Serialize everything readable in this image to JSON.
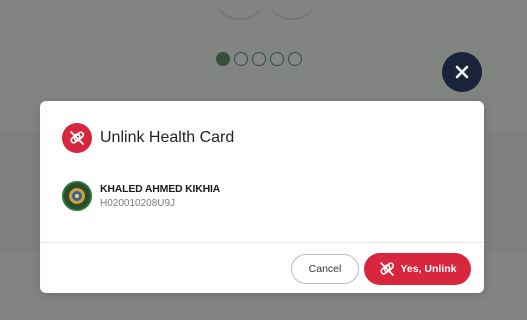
{
  "background": {
    "pager": {
      "count": 5,
      "active_index": 0,
      "color": "#2e6a3a"
    }
  },
  "close_button": {
    "icon": "close-icon",
    "color": "#19233a"
  },
  "modal": {
    "title": "Unlink Health Card",
    "title_icon": "unlink-icon",
    "member": {
      "name": "KHALED AHMED KIKHIA",
      "card_id": "H020010208U9J",
      "avatar": "avatar-emblem"
    },
    "actions": {
      "cancel_label": "Cancel",
      "confirm_label": "Yes, Unlink",
      "confirm_icon": "unlink-icon"
    },
    "accent_color": "#d7263d"
  }
}
